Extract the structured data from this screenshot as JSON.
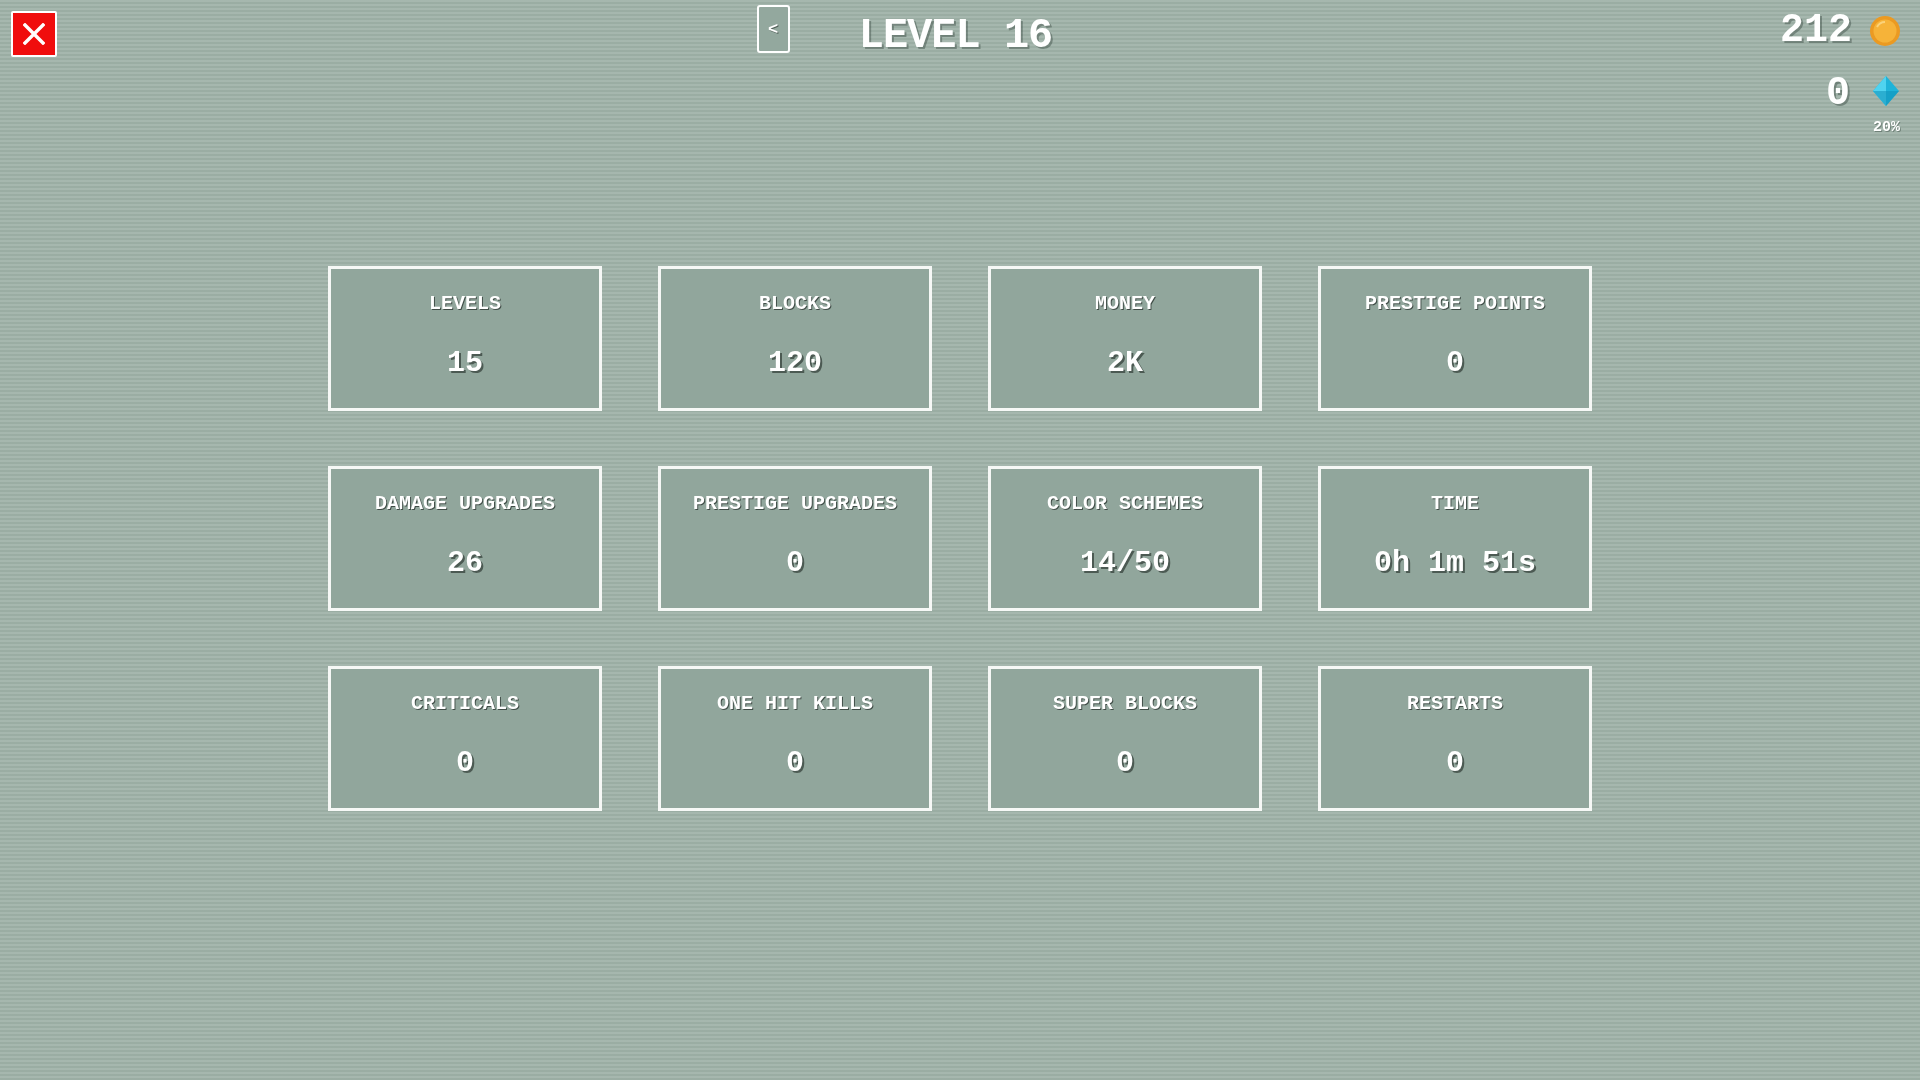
{
  "back_button": {
    "label": "<"
  },
  "title": "LEVEL 16",
  "currencies": [
    {
      "kind": "coin",
      "amount": "212"
    },
    {
      "kind": "gem",
      "amount": "0",
      "bonus": "20%"
    }
  ],
  "stats": [
    {
      "label": "LEVELS",
      "value": "15"
    },
    {
      "label": "BLOCKS",
      "value": "120"
    },
    {
      "label": "MONEY",
      "value": "2K"
    },
    {
      "label": "PRESTIGE POINTS",
      "value": "0"
    },
    {
      "label": "DAMAGE UPGRADES",
      "value": "26"
    },
    {
      "label": "PRESTIGE UPGRADES",
      "value": "0"
    },
    {
      "label": "COLOR SCHEMES",
      "value": "14/50"
    },
    {
      "label": "TIME",
      "value": "0h 1m 51s"
    },
    {
      "label": "CRITICALS",
      "value": "0"
    },
    {
      "label": "ONE HIT KILLS",
      "value": "0"
    },
    {
      "label": "SUPER BLOCKS",
      "value": "0"
    },
    {
      "label": "RESTARTS",
      "value": "0"
    }
  ]
}
